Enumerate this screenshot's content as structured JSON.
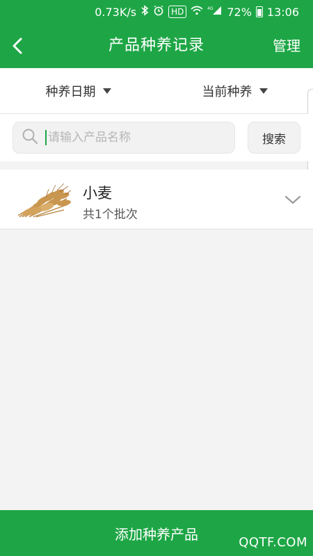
{
  "status_bar": {
    "network_speed": "0.73K/s",
    "hd_badge": "HD",
    "signal_label": "4G",
    "battery": "72%",
    "time": "13:06"
  },
  "header": {
    "title": "产品种养记录",
    "manage_label": "管理",
    "back_icon": "chevron-left-icon"
  },
  "filters": [
    {
      "label": "种养日期"
    },
    {
      "label": "当前种养"
    }
  ],
  "search": {
    "placeholder": "请输入产品名称",
    "value": "",
    "button_label": "搜索"
  },
  "list": [
    {
      "name": "小麦",
      "subtitle": "共1个批次",
      "thumbnail": "wheat-image"
    }
  ],
  "footer": {
    "button_label": "添加种养产品"
  },
  "watermark": "QQTF.COM",
  "colors": {
    "primary": "#1ea646",
    "background": "#f3f3f3"
  }
}
